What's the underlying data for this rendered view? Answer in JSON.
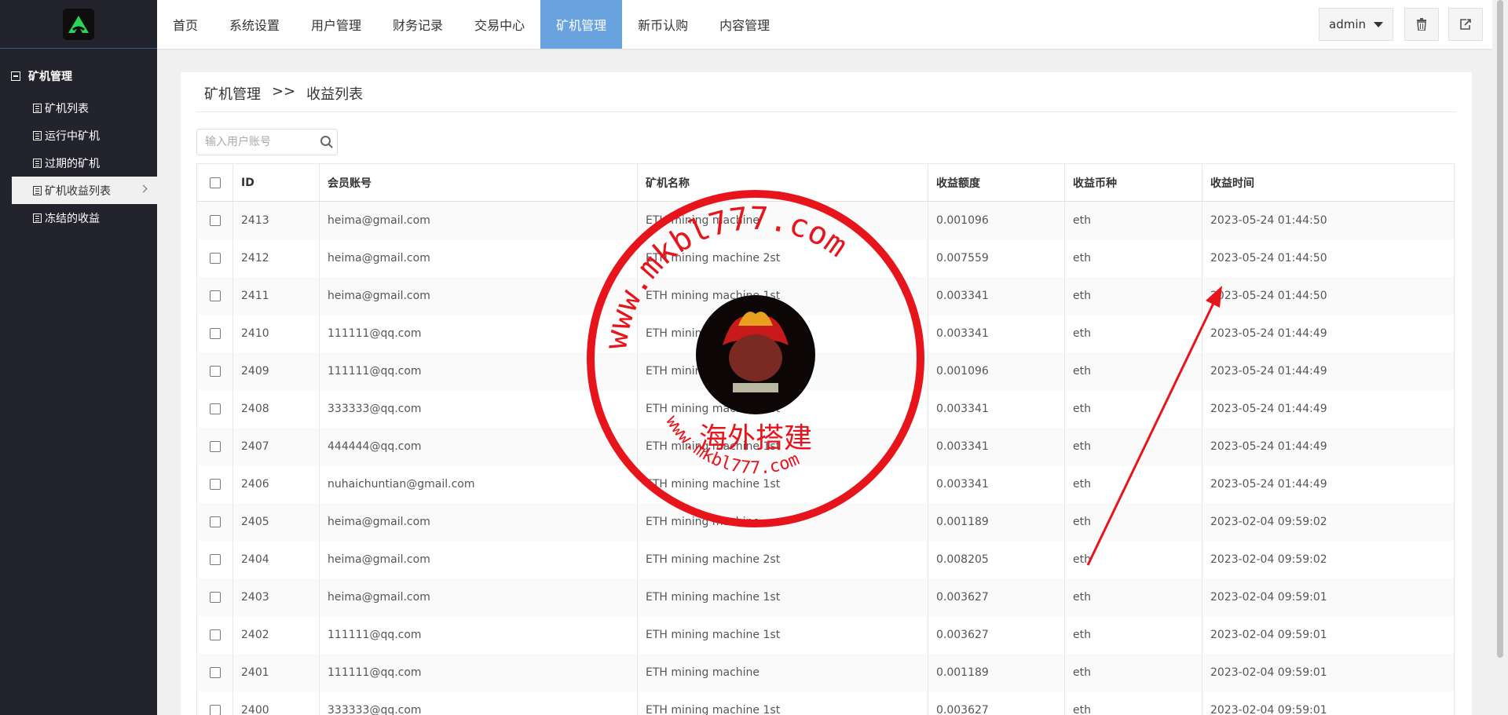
{
  "sidebar": {
    "group_title": "矿机管理",
    "items": [
      {
        "label": "矿机列表"
      },
      {
        "label": "运行中矿机"
      },
      {
        "label": "过期的矿机"
      },
      {
        "label": "矿机收益列表"
      },
      {
        "label": "冻结的收益"
      }
    ],
    "active_index": 3
  },
  "topnav": {
    "tabs": [
      {
        "label": "首页"
      },
      {
        "label": "系统设置"
      },
      {
        "label": "用户管理"
      },
      {
        "label": "财务记录"
      },
      {
        "label": "交易中心"
      },
      {
        "label": "矿机管理"
      },
      {
        "label": "新币认购"
      },
      {
        "label": "内容管理"
      }
    ],
    "active_index": 5,
    "user": "admin",
    "trash_icon": "trash-icon",
    "logout_icon": "logout-icon"
  },
  "breadcrumb": {
    "parent": "矿机管理",
    "separator": ">>",
    "current": "收益列表"
  },
  "search": {
    "placeholder": "输入用户账号",
    "value": ""
  },
  "table": {
    "headers": [
      "ID",
      "会员账号",
      "矿机名称",
      "收益额度",
      "收益币种",
      "收益时间"
    ],
    "rows": [
      {
        "id": "2413",
        "account": "heima@gmail.com",
        "machine": "ETH mining machine",
        "amount": "0.001096",
        "coin": "eth",
        "time": "2023-05-24 01:44:50"
      },
      {
        "id": "2412",
        "account": "heima@gmail.com",
        "machine": "ETH mining machine 2st",
        "amount": "0.007559",
        "coin": "eth",
        "time": "2023-05-24 01:44:50"
      },
      {
        "id": "2411",
        "account": "heima@gmail.com",
        "machine": "ETH mining machine 1st",
        "amount": "0.003341",
        "coin": "eth",
        "time": "2023-05-24 01:44:50"
      },
      {
        "id": "2410",
        "account": "111111@qq.com",
        "machine": "ETH mining machine 1st",
        "amount": "0.003341",
        "coin": "eth",
        "time": "2023-05-24 01:44:49"
      },
      {
        "id": "2409",
        "account": "111111@qq.com",
        "machine": "ETH mining machine",
        "amount": "0.001096",
        "coin": "eth",
        "time": "2023-05-24 01:44:49"
      },
      {
        "id": "2408",
        "account": "333333@qq.com",
        "machine": "ETH mining machine 1st",
        "amount": "0.003341",
        "coin": "eth",
        "time": "2023-05-24 01:44:49"
      },
      {
        "id": "2407",
        "account": "444444@qq.com",
        "machine": "ETH mining machine 1st",
        "amount": "0.003341",
        "coin": "eth",
        "time": "2023-05-24 01:44:49"
      },
      {
        "id": "2406",
        "account": "nuhaichuntian@gmail.com",
        "machine": "ETH mining machine 1st",
        "amount": "0.003341",
        "coin": "eth",
        "time": "2023-05-24 01:44:49"
      },
      {
        "id": "2405",
        "account": "heima@gmail.com",
        "machine": "ETH mining machine",
        "amount": "0.001189",
        "coin": "eth",
        "time": "2023-02-04 09:59:02"
      },
      {
        "id": "2404",
        "account": "heima@gmail.com",
        "machine": "ETH mining machine 2st",
        "amount": "0.008205",
        "coin": "eth",
        "time": "2023-02-04 09:59:02"
      },
      {
        "id": "2403",
        "account": "heima@gmail.com",
        "machine": "ETH mining machine 1st",
        "amount": "0.003627",
        "coin": "eth",
        "time": "2023-02-04 09:59:01"
      },
      {
        "id": "2402",
        "account": "111111@qq.com",
        "machine": "ETH mining machine 1st",
        "amount": "0.003627",
        "coin": "eth",
        "time": "2023-02-04 09:59:01"
      },
      {
        "id": "2401",
        "account": "111111@qq.com",
        "machine": "ETH mining machine",
        "amount": "0.001189",
        "coin": "eth",
        "time": "2023-02-04 09:59:01"
      },
      {
        "id": "2400",
        "account": "333333@qq.com",
        "machine": "ETH mining machine 1st",
        "amount": "0.003627",
        "coin": "eth",
        "time": "2023-02-04 09:59:01"
      }
    ]
  },
  "watermark": {
    "top_text": "www.mkbl777.com",
    "bottom_text": "www.mkbl777.com",
    "center_text": "海外搭建",
    "color": "#e8141c"
  },
  "colors": {
    "sidebar_bg": "#23232e",
    "active_tab": "#69a3e0",
    "logo_green": "#2bd45a"
  }
}
